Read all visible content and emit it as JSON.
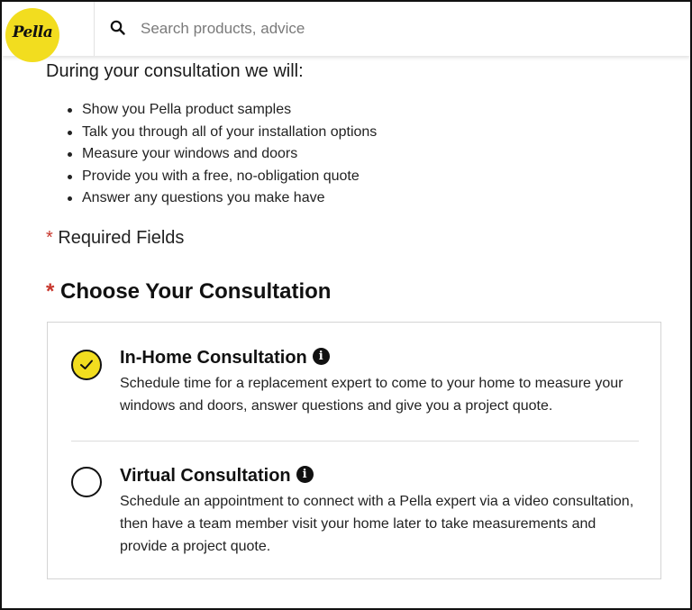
{
  "header": {
    "logo_text": "Pella",
    "search": {
      "placeholder": "Search products, advice",
      "value": "",
      "icon": "search-icon"
    }
  },
  "intro": {
    "heading": "During your consultation we will:",
    "bullets": [
      "Show you Pella product samples",
      "Talk you through all of your installation options",
      "Measure your windows and doors",
      "Provide you with a free, no-obligation quote",
      "Answer any questions you make have"
    ]
  },
  "form": {
    "required_marker": "*",
    "required_note": "Required Fields",
    "choose_heading": "Choose Your Consultation",
    "options": [
      {
        "title": "In-Home Consultation",
        "description": "Schedule time for a replacement expert to come to your home to measure your windows and doors, answer questions and give you a project quote.",
        "selected": true,
        "info_glyph": "i"
      },
      {
        "title": "Virtual Consultation",
        "description": "Schedule an appointment to connect with a Pella expert via a video consultation, then have a team member visit your home later to take measurements and provide a project quote.",
        "selected": false,
        "info_glyph": "i"
      }
    ]
  },
  "colors": {
    "brand_yellow": "#f2dd1f",
    "required_red": "#c8372d",
    "text": "#222222"
  }
}
